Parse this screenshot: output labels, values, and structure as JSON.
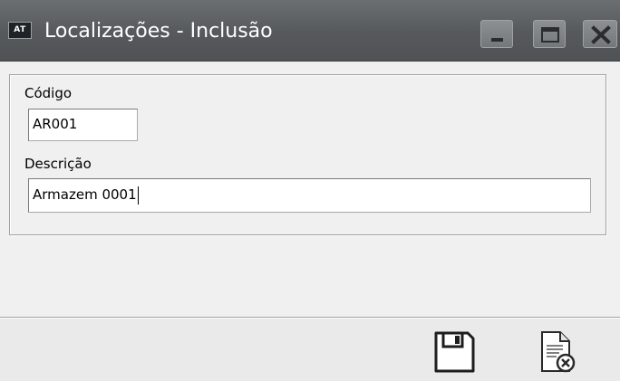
{
  "window": {
    "app_badge": "AT",
    "title": "Localizações - Inclusão",
    "controls": {
      "minimize": "minimize-icon",
      "maximize": "maximize-icon",
      "close": "close-icon"
    }
  },
  "form": {
    "codigo": {
      "label": "Código",
      "value": "AR001"
    },
    "descricao": {
      "label": "Descrição",
      "value": "Armazem 0001"
    }
  },
  "toolbar": {
    "save_icon": "save-icon",
    "cancel_icon": "cancel-document-icon"
  },
  "colors": {
    "titlebar": "#56595c",
    "title_text": "#ffffff",
    "window_bg": "#f0f0f0"
  }
}
